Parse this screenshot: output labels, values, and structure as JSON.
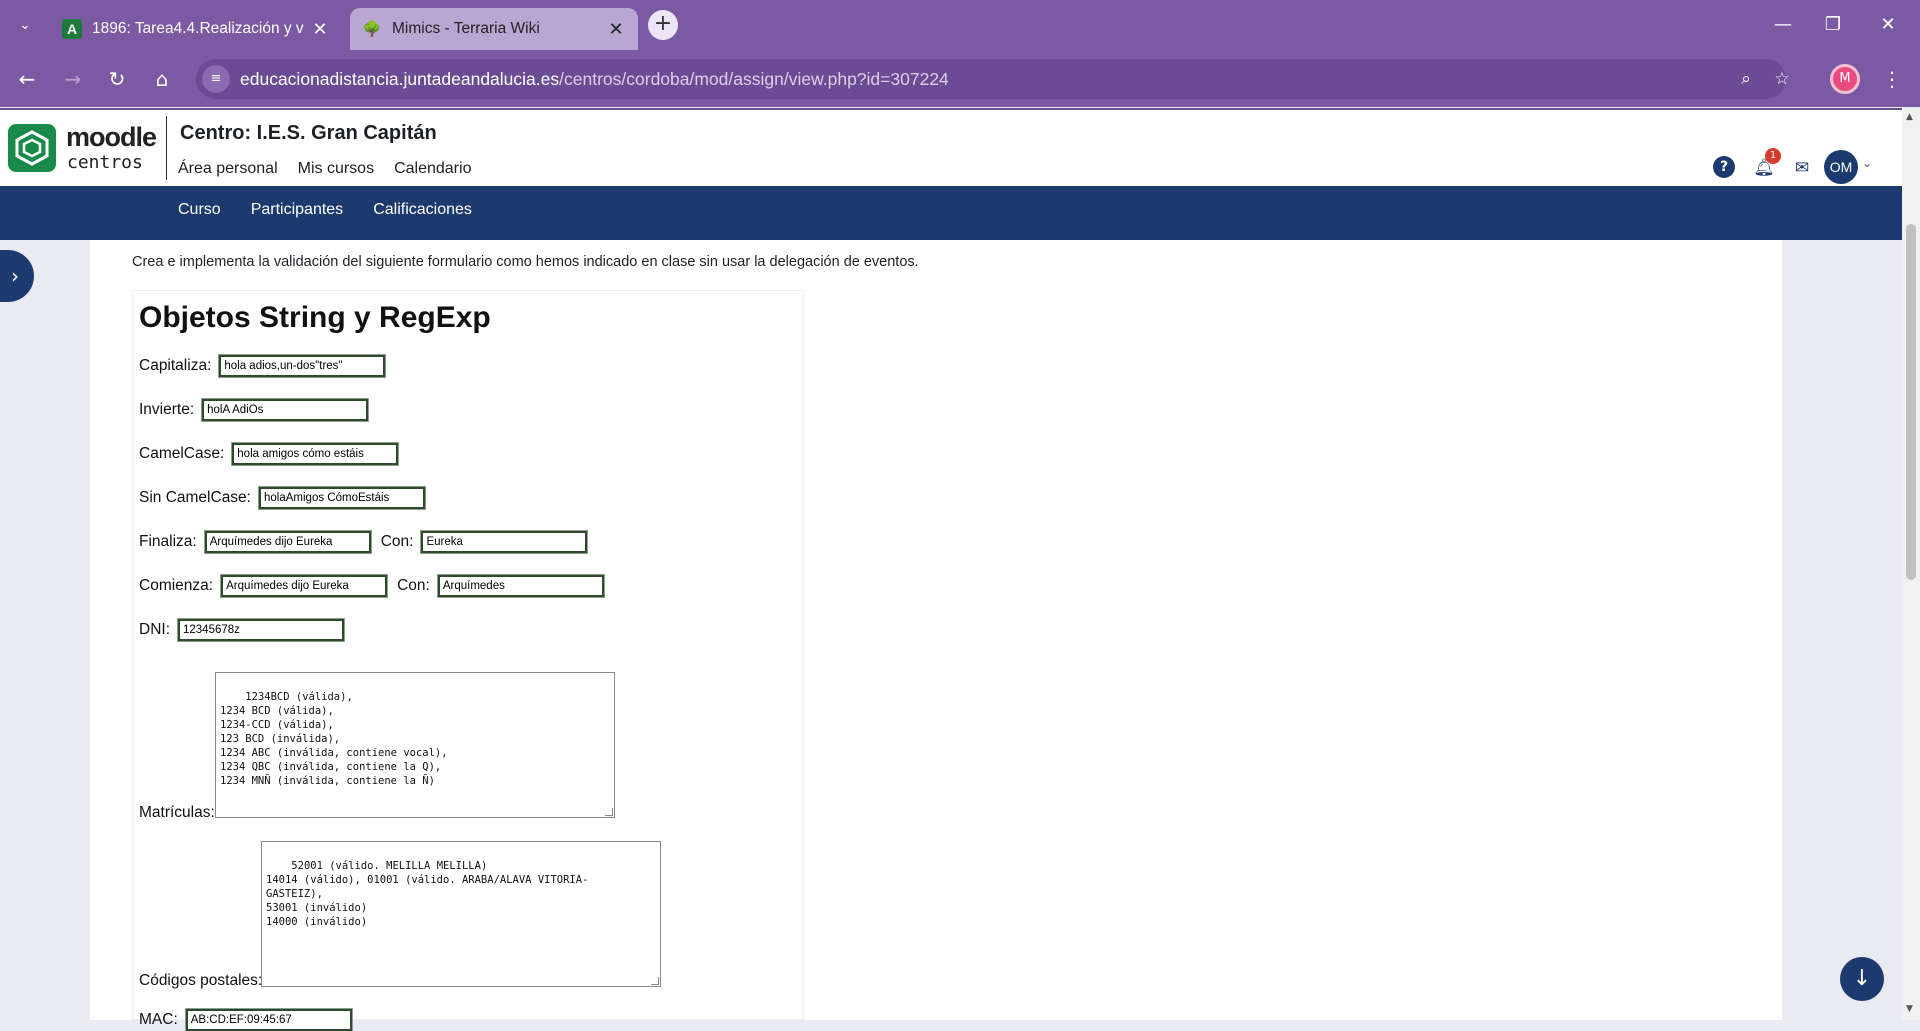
{
  "browser": {
    "tabs": [
      {
        "title": "1896: Tarea4.4.Realización y vali",
        "favicon": "A",
        "close": "✕"
      },
      {
        "title": "Mimics - Terraria Wiki",
        "favicon": "🌳",
        "close": "✕"
      }
    ],
    "new_tab": "+",
    "url_host": "educacionadistancia.juntadeandalucia.es",
    "url_path": "/centros/cordoba/mod/assign/view.php?id=307224",
    "profile_initial": "M"
  },
  "moodle": {
    "logo_line1": "moodle",
    "logo_line2": "centros",
    "centro_title": "Centro:  I.E.S. Gran Capitán",
    "primary_nav": [
      "Área personal",
      "Mis cursos",
      "Calendario"
    ],
    "notif_count": "1",
    "user_initials": "OM",
    "secondary_nav": [
      "Curso",
      "Participantes",
      "Calificaciones"
    ]
  },
  "page": {
    "intro": "Crea e implementa la validación del siguiente formulario como hemos indicado en clase sin usar la delegación de eventos.",
    "form_title": "Objetos String y RegExp",
    "fields": {
      "capitaliza": {
        "label": "Capitaliza:",
        "value": "hola adios,un-dos\"tres\""
      },
      "invierte": {
        "label": "Invierte:",
        "value": "holA AdiOs"
      },
      "camelcase": {
        "label": "CamelCase:",
        "value": "hola amigos cómo estáis"
      },
      "sincamel": {
        "label": "Sin CamelCase:",
        "value": "holaAmigos CómoEstáis"
      },
      "finaliza": {
        "label": "Finaliza:",
        "value": "Arquímedes dijo Eureka",
        "con_label": "Con:",
        "con_value": "Eureka"
      },
      "comienza": {
        "label": "Comienza:",
        "value": "Arquímedes dijo Eureka",
        "con_label": "Con:",
        "con_value": "Arquímedes"
      },
      "dni": {
        "label": "DNI:",
        "value": "12345678z"
      },
      "matriculas": {
        "label": "Matrículas:",
        "value": "1234BCD (válida),\n1234 BCD (válida),\n1234-CCD (válida),\n123 BCD (inválida),\n1234 ABC (inválida, contiene vocal),\n1234 QBC (inválida, contiene la Q),\n1234 MNÑ (inválida, contiene la Ñ)"
      },
      "codigos": {
        "label": "Códigos postales:",
        "value": "52001 (válido. MELILLA MELILLA)\n14014 (válido), 01001 (válido. ARABA/ALAVA VITORIA-\nGASTEIZ),\n53001 (inválido)\n14000 (inválido)"
      },
      "mac": {
        "label": "MAC:",
        "value": "AB:CD:EF:09:45:67"
      }
    }
  }
}
